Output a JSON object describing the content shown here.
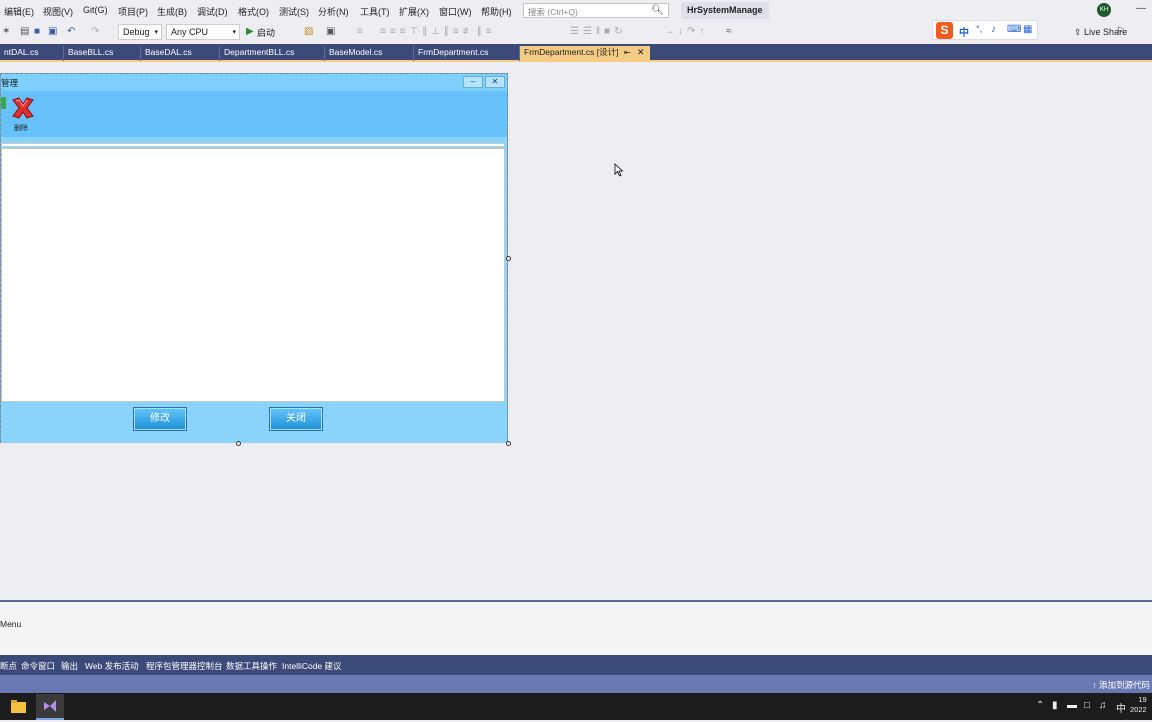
{
  "menu": {
    "items": [
      "编辑(E)",
      "视图(V)",
      "Git(G)",
      "项目(P)",
      "生成(B)",
      "调试(D)",
      "格式(O)",
      "测试(S)",
      "分析(N)",
      "工具(T)",
      "扩展(X)",
      "窗口(W)",
      "帮助(H)"
    ],
    "search_placeholder": "搜索 (Ctrl+Q)",
    "solution_name": "HrSystemManage",
    "avatar_initials": "KH"
  },
  "toolbar": {
    "config": "Debug",
    "platform": "Any CPU",
    "start_label": "启动",
    "live_share": "Live Share"
  },
  "tabs": [
    {
      "label": "ntDAL.cs"
    },
    {
      "label": "BaseBLL.cs"
    },
    {
      "label": "BaseDAL.cs"
    },
    {
      "label": "DepartmentBLL.cs"
    },
    {
      "label": "BaseModel.cs"
    },
    {
      "label": "FrmDepartment.cs"
    },
    {
      "label": "FrmDepartment.cs [设计]",
      "active": true
    }
  ],
  "form": {
    "title": "管理",
    "delete_label": "删除",
    "modify_button": "修改",
    "close_button": "关闭"
  },
  "output": {
    "label": "Menu"
  },
  "tool_tabs": [
    "断点",
    "命令窗口",
    "输出",
    "Web 发布活动",
    "程序包管理器控制台",
    "数据工具操作",
    "IntelliCode 建议"
  ],
  "status": {
    "right": "添加到源代码"
  },
  "taskbar": {
    "ime": "中",
    "clock_line1": "19",
    "clock_line2": "2022"
  },
  "colors": {
    "accent_tab": "#f5cc84",
    "tabstrip": "#3c4a7a",
    "form_bg": "#8ad3fb"
  }
}
